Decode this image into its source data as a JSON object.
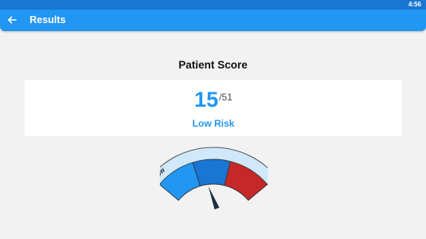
{
  "status_bar": {
    "time": "4:56"
  },
  "app_bar": {
    "title": "Results",
    "back_icon": "arrow-left-icon"
  },
  "score": {
    "heading": "Patient Score",
    "value": "15",
    "max": "/51",
    "risk_label": "Low Risk"
  },
  "gauge": {
    "zone_label": "LOW",
    "level_fraction": 0.29,
    "colors": {
      "low": "#2196f3",
      "medium_low": "#1976d2",
      "high": "#c62828",
      "rim": "#cfe8fb"
    }
  }
}
